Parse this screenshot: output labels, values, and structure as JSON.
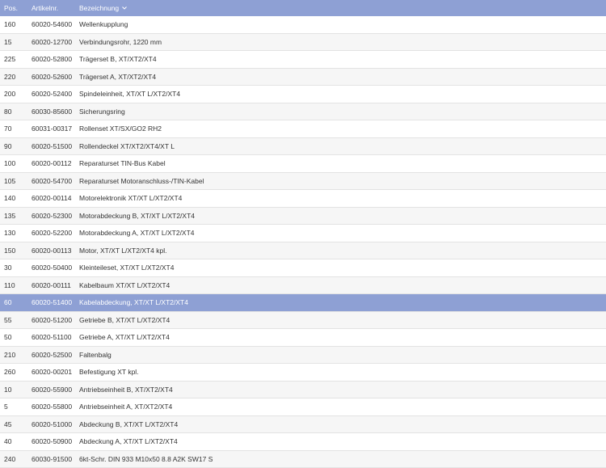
{
  "table": {
    "headers": {
      "pos": "Pos.",
      "artikel": "Artikelnr.",
      "bezeichnung": "Bezeichnung"
    },
    "sort_icon": "chevron-down-icon",
    "accent_color": "#8ea0d4",
    "selected_row_index": 16,
    "rows": [
      {
        "pos": "160",
        "artikel": "60020-54600",
        "bezeichnung": "Wellenkupplung"
      },
      {
        "pos": "15",
        "artikel": "60020-12700",
        "bezeichnung": "Verbindungsrohr, 1220 mm"
      },
      {
        "pos": "225",
        "artikel": "60020-52800",
        "bezeichnung": "Trägerset B, XT/XT2/XT4"
      },
      {
        "pos": "220",
        "artikel": "60020-52600",
        "bezeichnung": "Trägerset A, XT/XT2/XT4"
      },
      {
        "pos": "200",
        "artikel": "60020-52400",
        "bezeichnung": "Spindeleinheit, XT/XT L/XT2/XT4"
      },
      {
        "pos": "80",
        "artikel": "60030-85600",
        "bezeichnung": "Sicherungsring"
      },
      {
        "pos": "70",
        "artikel": "60031-00317",
        "bezeichnung": "Rollenset XT/SX/GO2 RH2"
      },
      {
        "pos": "90",
        "artikel": "60020-51500",
        "bezeichnung": "Rollendeckel XT/XT2/XT4/XT L"
      },
      {
        "pos": "100",
        "artikel": "60020-00112",
        "bezeichnung": "Reparaturset TIN-Bus Kabel"
      },
      {
        "pos": "105",
        "artikel": "60020-54700",
        "bezeichnung": "Reparaturset Motoranschluss-/TIN-Kabel"
      },
      {
        "pos": "140",
        "artikel": "60020-00114",
        "bezeichnung": "Motorelektronik XT/XT L/XT2/XT4"
      },
      {
        "pos": "135",
        "artikel": "60020-52300",
        "bezeichnung": "Motorabdeckung B, XT/XT L/XT2/XT4"
      },
      {
        "pos": "130",
        "artikel": "60020-52200",
        "bezeichnung": "Motorabdeckung A, XT/XT L/XT2/XT4"
      },
      {
        "pos": "150",
        "artikel": "60020-00113",
        "bezeichnung": "Motor, XT/XT L/XT2/XT4 kpl."
      },
      {
        "pos": "30",
        "artikel": "60020-50400",
        "bezeichnung": "Kleinteileset, XT/XT L/XT2/XT4"
      },
      {
        "pos": "110",
        "artikel": "60020-00111",
        "bezeichnung": "Kabelbaum XT/XT L/XT2/XT4"
      },
      {
        "pos": "60",
        "artikel": "60020-51400",
        "bezeichnung": "Kabelabdeckung, XT/XT L/XT2/XT4"
      },
      {
        "pos": "55",
        "artikel": "60020-51200",
        "bezeichnung": "Getriebe B, XT/XT L/XT2/XT4"
      },
      {
        "pos": "50",
        "artikel": "60020-51100",
        "bezeichnung": "Getriebe A, XT/XT L/XT2/XT4"
      },
      {
        "pos": "210",
        "artikel": "60020-52500",
        "bezeichnung": "Faltenbalg"
      },
      {
        "pos": "260",
        "artikel": "60020-00201",
        "bezeichnung": "Befestigung XT kpl."
      },
      {
        "pos": "10",
        "artikel": "60020-55900",
        "bezeichnung": "Antriebseinheit B, XT/XT2/XT4"
      },
      {
        "pos": "5",
        "artikel": "60020-55800",
        "bezeichnung": "Antriebseinheit A, XT/XT2/XT4"
      },
      {
        "pos": "45",
        "artikel": "60020-51000",
        "bezeichnung": "Abdeckung B, XT/XT L/XT2/XT4"
      },
      {
        "pos": "40",
        "artikel": "60020-50900",
        "bezeichnung": "Abdeckung A, XT/XT L/XT2/XT4"
      },
      {
        "pos": "240",
        "artikel": "60030-91500",
        "bezeichnung": "6kt-Schr. DIN 933 M10x50 8.8 A2K SW17 S"
      }
    ]
  }
}
